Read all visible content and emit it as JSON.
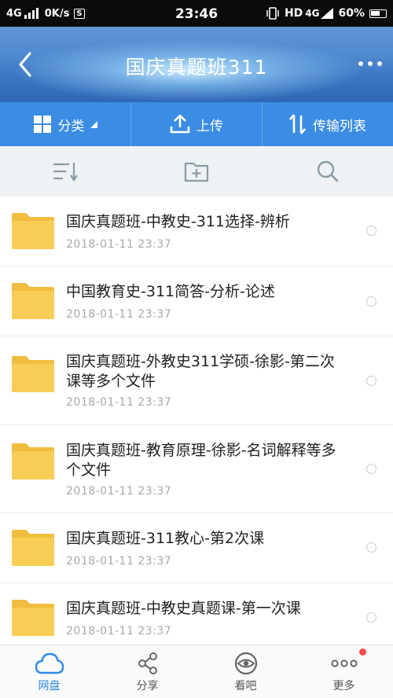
{
  "status_bar": {
    "network": "4G",
    "speed": "0K/s",
    "s_badge": "S",
    "time": "23:46",
    "hd": "HD",
    "network2": "4G",
    "battery": "60%"
  },
  "header": {
    "title": "国庆真题班311"
  },
  "toolbar": {
    "category_label": "分类",
    "upload_label": "上传",
    "transfer_label": "传输列表"
  },
  "files": [
    {
      "name": "国庆真题班-中教史-311选择-辨析",
      "date": "2018-01-11  23:37"
    },
    {
      "name": "中国教育史-311简答-分析-论述",
      "date": "2018-01-11  23:37"
    },
    {
      "name": "国庆真题班-外教史311学硕-徐影-第二次课等多个文件",
      "date": "2018-01-11  23:37"
    },
    {
      "name": "国庆真题班-教育原理-徐影-名词解释等多个文件",
      "date": "2018-01-11  23:37"
    },
    {
      "name": "国庆真题班-311教心-第2次课",
      "date": "2018-01-11  23:37"
    },
    {
      "name": "国庆真题班-中教史真题课-第一次课",
      "date": "2018-01-11  23:37"
    }
  ],
  "bottom_nav": [
    {
      "label": "网盘",
      "icon": "cloud-icon",
      "active": true
    },
    {
      "label": "分享",
      "icon": "share-icon",
      "active": false
    },
    {
      "label": "看吧",
      "icon": "eye-icon",
      "active": false
    },
    {
      "label": "更多",
      "icon": "more-dots-icon",
      "active": false,
      "badge": true
    }
  ],
  "colors": {
    "accent": "#3a8de3",
    "active_nav": "#2b8ae6",
    "folder": "#f5c84c",
    "badge": "#f34b4b"
  }
}
